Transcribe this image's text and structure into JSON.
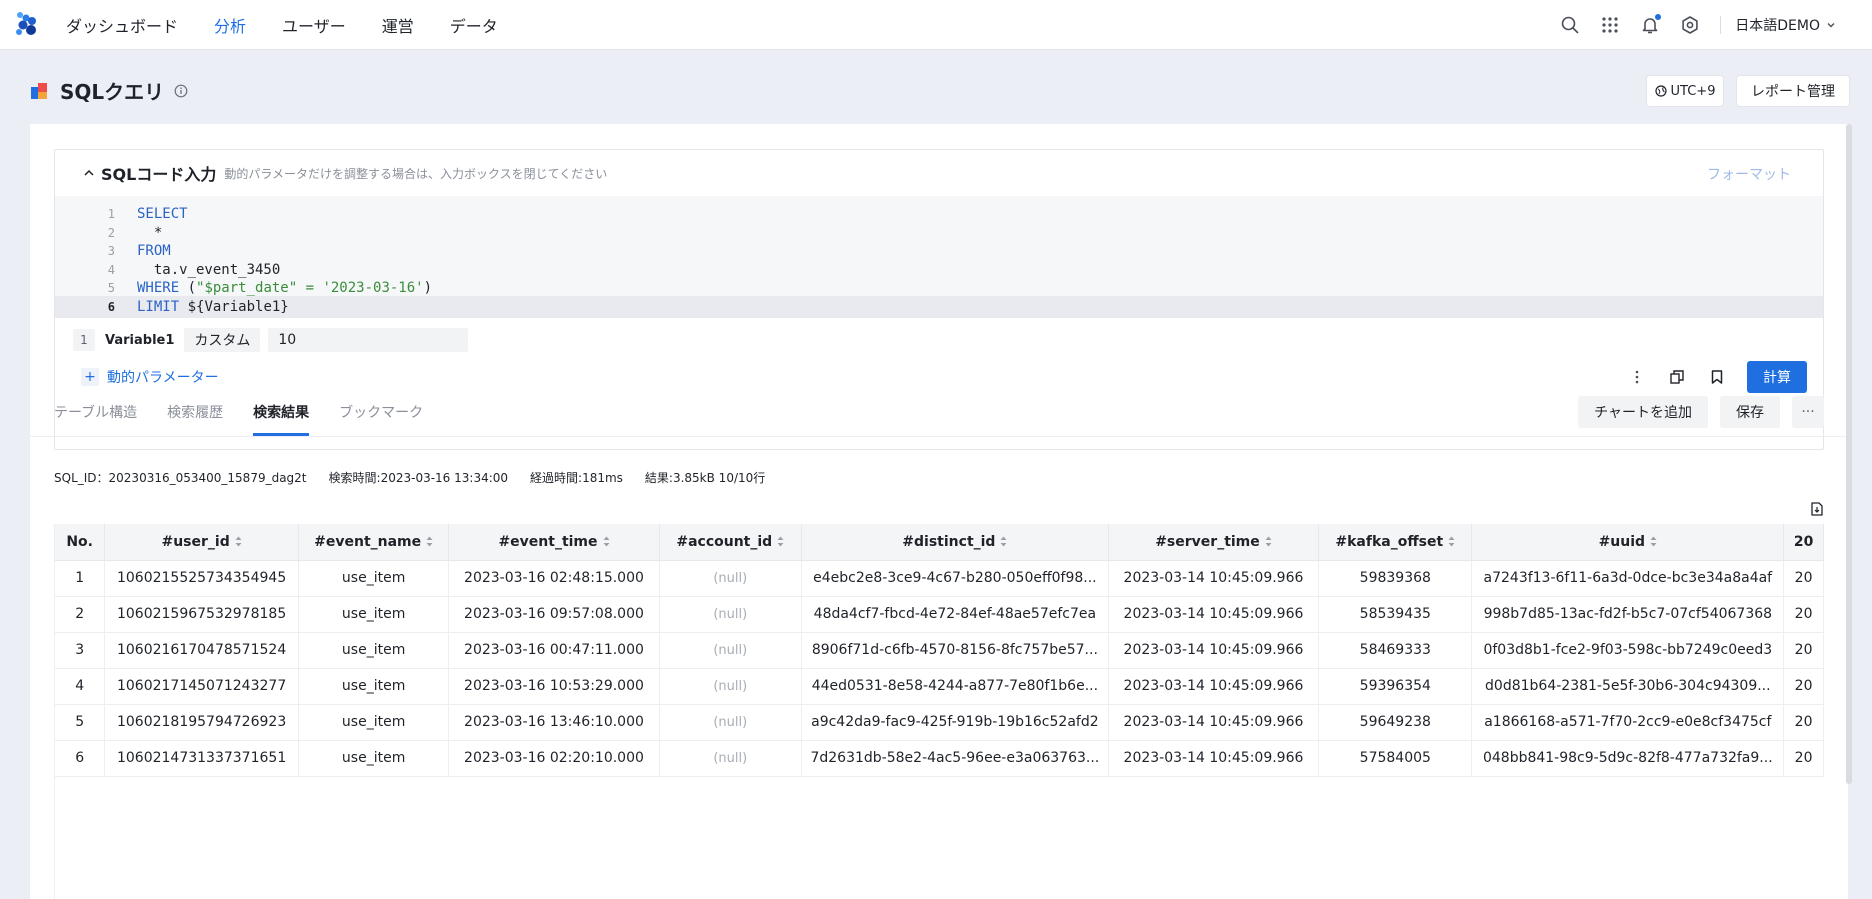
{
  "nav": {
    "items": [
      "ダッシュボード",
      "分析",
      "ユーザー",
      "運営",
      "データ"
    ],
    "active_index": 1,
    "workspace": "日本語DEMO"
  },
  "icons": {
    "search": "search-icon",
    "apps": "grid-icon",
    "notifications": "bell-icon",
    "settings": "gear-icon"
  },
  "page": {
    "title": "SQLクエリ",
    "timezone": "UTC+9",
    "report_btn": "レポート管理"
  },
  "sql": {
    "title": "SQLコード入力",
    "hint": "動的パラメータだけを調整する場合は、入力ボックスを閉じてください",
    "format": "フォーマット",
    "lines": [
      {
        "n": "1",
        "parts": [
          {
            "t": "SELECT",
            "c": "kw"
          }
        ]
      },
      {
        "n": "2",
        "parts": [
          {
            "t": "  *",
            "c": ""
          }
        ]
      },
      {
        "n": "3",
        "parts": [
          {
            "t": "FROM",
            "c": "kw"
          }
        ]
      },
      {
        "n": "4",
        "parts": [
          {
            "t": "  ta.v_event_3450",
            "c": ""
          }
        ]
      },
      {
        "n": "5",
        "parts": [
          {
            "t": "WHERE",
            "c": "kw"
          },
          {
            "t": " (",
            "c": ""
          },
          {
            "t": "\"$part_date\" = '2023-03-16'",
            "c": "str"
          },
          {
            "t": ")",
            "c": ""
          }
        ]
      },
      {
        "n": "6",
        "parts": [
          {
            "t": "LIMIT",
            "c": "kw"
          },
          {
            "t": " ${Variable1}",
            "c": ""
          }
        ]
      }
    ],
    "active_line": 6,
    "param": {
      "index": "1",
      "name": "Variable1",
      "type": "カスタム",
      "value": "10"
    },
    "add_param": "動的パラメーター",
    "run": "計算"
  },
  "tabs": {
    "items": [
      "テーブル構造",
      "検索履歴",
      "検索結果",
      "ブックマーク"
    ],
    "active_index": 2,
    "add_chart": "チャートを追加",
    "save": "保存",
    "more": "···"
  },
  "meta": {
    "sql_id": "SQL_ID：20230316_053400_15879_dag2t",
    "query_time": "検索時間:2023-03-16 13:34:00",
    "elapsed": "経過時間:181ms",
    "result": "結果:3.85kB 10/10行"
  },
  "table": {
    "columns": [
      "No.",
      "#user_id",
      "#event_name",
      "#event_time",
      "#account_id",
      "#distinct_id",
      "#server_time",
      "#kafka_offset",
      "#uuid",
      "20"
    ],
    "rows": [
      [
        "1",
        "1060215525734354945",
        "use_item",
        "2023-03-16 02:48:15.000",
        "(null)",
        "e4ebc2e8-3ce9-4c67-b280-050eff0f98...",
        "2023-03-14 10:45:09.966",
        "59839368",
        "a7243f13-6f11-6a3d-0dce-bc3e34a8a4af",
        "20"
      ],
      [
        "2",
        "1060215967532978185",
        "use_item",
        "2023-03-16 09:57:08.000",
        "(null)",
        "48da4cf7-fbcd-4e72-84ef-48ae57efc7ea",
        "2023-03-14 10:45:09.966",
        "58539435",
        "998b7d85-13ac-fd2f-b5c7-07cf54067368",
        "20"
      ],
      [
        "3",
        "1060216170478571524",
        "use_item",
        "2023-03-16 00:47:11.000",
        "(null)",
        "8906f71d-c6fb-4570-8156-8fc757be57...",
        "2023-03-14 10:45:09.966",
        "58469333",
        "0f03d8b1-fce2-9f03-598c-bb7249c0eed3",
        "20"
      ],
      [
        "4",
        "1060217145071243277",
        "use_item",
        "2023-03-16 10:53:29.000",
        "(null)",
        "44ed0531-8e58-4244-a877-7e80f1b6e...",
        "2023-03-14 10:45:09.966",
        "59396354",
        "d0d81b64-2381-5e5f-30b6-304c94309...",
        "20"
      ],
      [
        "5",
        "1060218195794726923",
        "use_item",
        "2023-03-16 13:46:10.000",
        "(null)",
        "a9c42da9-fac9-425f-919b-19b16c52afd2",
        "2023-03-14 10:45:09.966",
        "59649238",
        "a1866168-a571-7f70-2cc9-e0e8cf3475cf",
        "20"
      ],
      [
        "6",
        "1060214731337371651",
        "use_item",
        "2023-03-16 02:20:10.000",
        "(null)",
        "7d2631db-58e2-4ac5-96ee-e3a063763...",
        "2023-03-14 10:45:09.966",
        "57584005",
        "048bb841-98c9-5d9c-82f8-477a732fa9...",
        "20"
      ]
    ]
  },
  "colors": {
    "accent": "#1f6fe0",
    "null_text": "#a8adb5"
  }
}
